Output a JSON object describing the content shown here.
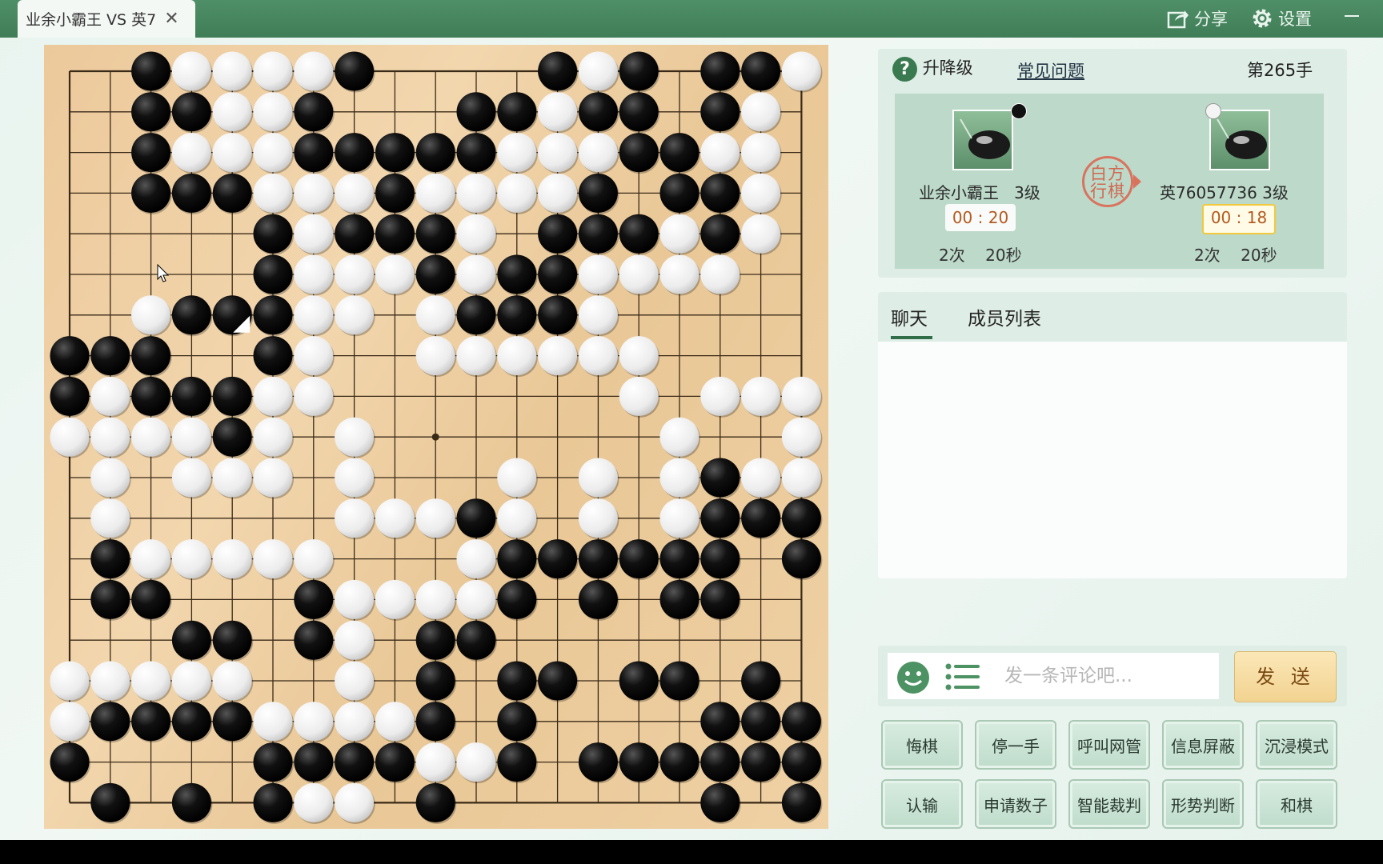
{
  "tab": {
    "title": "业余小霸王 VS 英7"
  },
  "toolbar": {
    "share_label": "分享",
    "settings_label": "设置"
  },
  "info": {
    "level_label": "升降级",
    "faq_label": "常见问题",
    "move_label": "第265手",
    "turn_seal": [
      "白方",
      "行棋"
    ]
  },
  "players": [
    {
      "name": "业余小霸王",
      "rank": "3级",
      "stone": "black",
      "time": "00 : 20",
      "byoyomi_count": "2次",
      "byoyomi_time": "20秒",
      "active": false
    },
    {
      "name": "英76057736",
      "rank": "3级",
      "stone": "white",
      "time": "00 : 18",
      "byoyomi_count": "2次",
      "byoyomi_time": "20秒",
      "active": true
    }
  ],
  "chat": {
    "tabs": [
      "聊天",
      "成员列表"
    ],
    "input_placeholder": "发一条评论吧...",
    "send_label": "发 送"
  },
  "actions": [
    "悔棋",
    "停一手",
    "呼叫网管",
    "信息屏蔽",
    "沉浸模式",
    "认输",
    "申请数子",
    "智能裁判",
    "形势判断",
    "和棋"
  ],
  "board": {
    "size": 19,
    "rows": [
      "--BWWWWB----BWB-BBW",
      "--BBWWB---BBWBB-BW-",
      "--BWWWBBBBBWWWBBWW-",
      "--BBBWWWBWWWWB-BBW-",
      "-----BWBBBW-BBBWBW-",
      "-----BWWWBWBBWWWW--",
      "--WBBBWW-WBBBW-----",
      "BBB--BW--WWWWWW----",
      "BWBBBWW-------W-WWW",
      "WWWWBW-W-------W--W",
      "-W-WWW-W---W-W-WBWW",
      "-W-----WWWBW-W-WBBB",
      "-BWWWWW---WBBBBBB-B",
      "-BB---BWWWWB-B-BB--",
      "---BB-BW-BB--------",
      "WWWWW--W-B-BB-BB-B-",
      "WBBBBWWWWB-B----BBB",
      "B----BBBBWWB-BBBBBB",
      "-B-B-BWW-B------B-B"
    ],
    "last_move": {
      "row": 6,
      "col": 4
    }
  }
}
